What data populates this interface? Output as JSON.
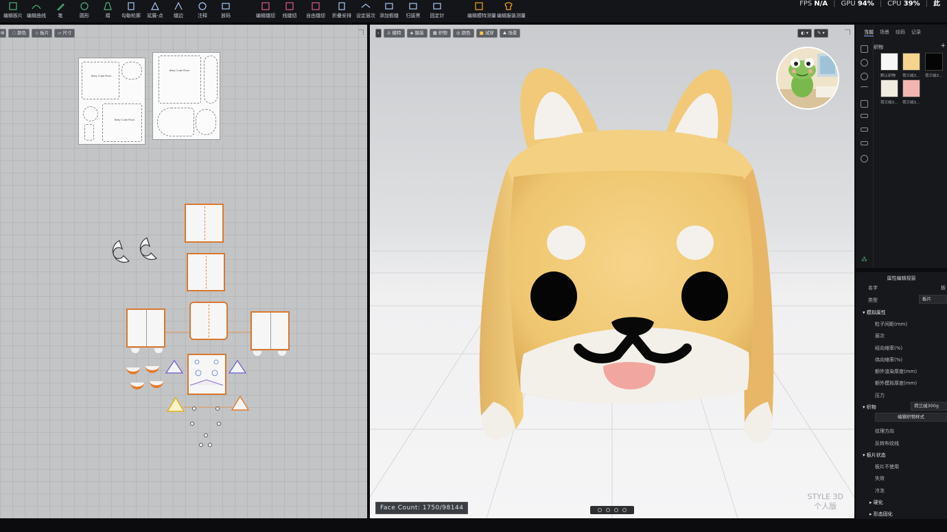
{
  "toolbar": {
    "tools": [
      {
        "label": "编辑板片",
        "icon": "edit-pattern-icon"
      },
      {
        "label": "编辑曲线",
        "icon": "edit-curve-icon"
      },
      {
        "label": "笔",
        "icon": "pen-icon"
      },
      {
        "label": "圆形",
        "icon": "circle-icon"
      },
      {
        "label": "褶",
        "icon": "pleat-icon"
      },
      {
        "label": "勾勒轮廓",
        "icon": "trace-outline-icon"
      },
      {
        "label": "延展-点",
        "icon": "extend-point-icon"
      },
      {
        "label": "缝边",
        "icon": "seam-allowance-icon"
      },
      {
        "label": "注释",
        "icon": "annotation-icon"
      },
      {
        "label": "放码",
        "icon": "grading-icon"
      },
      {
        "label": "编辑缝纫",
        "icon": "edit-sewing-icon"
      },
      {
        "label": "线缝纫",
        "icon": "line-sewing-icon"
      },
      {
        "label": "自由缝纫",
        "icon": "free-sewing-icon"
      },
      {
        "label": "折叠安排",
        "icon": "fold-arrange-icon"
      },
      {
        "label": "设定层次",
        "icon": "set-layer-icon"
      },
      {
        "label": "添加假缝",
        "icon": "add-tack-icon"
      },
      {
        "label": "归拔黑",
        "icon": "shrink-icon"
      },
      {
        "label": "固定针",
        "icon": "pin-icon"
      },
      {
        "label": "编辑模特测量",
        "icon": "edit-avatar-measure-icon"
      },
      {
        "label": "编辑服装测量",
        "icon": "edit-garment-measure-icon"
      }
    ],
    "fps_label": "FPS",
    "fps_value": "N/A",
    "gpu_label": "GPU",
    "gpu_value": "94%",
    "cpu_label": "CPU",
    "cpu_value": "39%",
    "extra": "此"
  },
  "view2d": {
    "buttons": [
      "显示",
      "颜色",
      "板片",
      "尺寸"
    ],
    "sheet1": {
      "title": "Baby Cube Plush",
      "label2": "Baby Cube Plush"
    },
    "sheet2": {
      "title": "Baby Cube Plush"
    }
  },
  "view3d": {
    "buttons": [
      "模特",
      "服装",
      "织物",
      "颜色",
      "试穿",
      "场景"
    ],
    "face_count_label": "Face Count:",
    "face_count_value": "1750/98144",
    "watermark_line1": "STYLE 3D",
    "watermark_line2": "个人版"
  },
  "right_panel": {
    "tabs": [
      "当前",
      "场景",
      "纹码",
      "记录"
    ],
    "fabric_title": "织物",
    "fabric_add": "+",
    "fabrics": [
      {
        "label": "默认织物",
        "color": "#f7f7f7"
      },
      {
        "label": "荷兰绒3...",
        "color": "#f5d48e"
      },
      {
        "label": "荷兰绒3...",
        "color": "#050505"
      },
      {
        "label": "荷兰绒3...",
        "color": "#f1ebe0"
      },
      {
        "label": "荷兰绒3...",
        "color": "#f2b5b0"
      }
    ]
  },
  "properties": {
    "title": "属性编辑视窗",
    "name_label": "名字",
    "name_value": "板",
    "type_label": "类型",
    "type_value": "板片",
    "sim_section": "模拟属性",
    "sim_rows": [
      "粒子间距(mm)",
      "层次",
      "经向缩率(%)",
      "纬向缩率(%)",
      "额外渲染厚度(mm)",
      "额外模拟厚度(mm)",
      "压力"
    ],
    "fabric_label": "织物",
    "fabric_value": "荷兰绒300g",
    "edit_fabric_button": "编辑织物样式",
    "grain_row": "纹理方向",
    "reverse_row": "反转布纹线",
    "state_section": "板片状态",
    "state_rows": [
      "板片不使用",
      "失效",
      "冷冻"
    ],
    "harden": "硬化",
    "shape_harden": "形态固化"
  },
  "colors": {
    "accent": "#e37b2c",
    "plush": "#f2cd7c",
    "panel_bg": "#17181b"
  }
}
